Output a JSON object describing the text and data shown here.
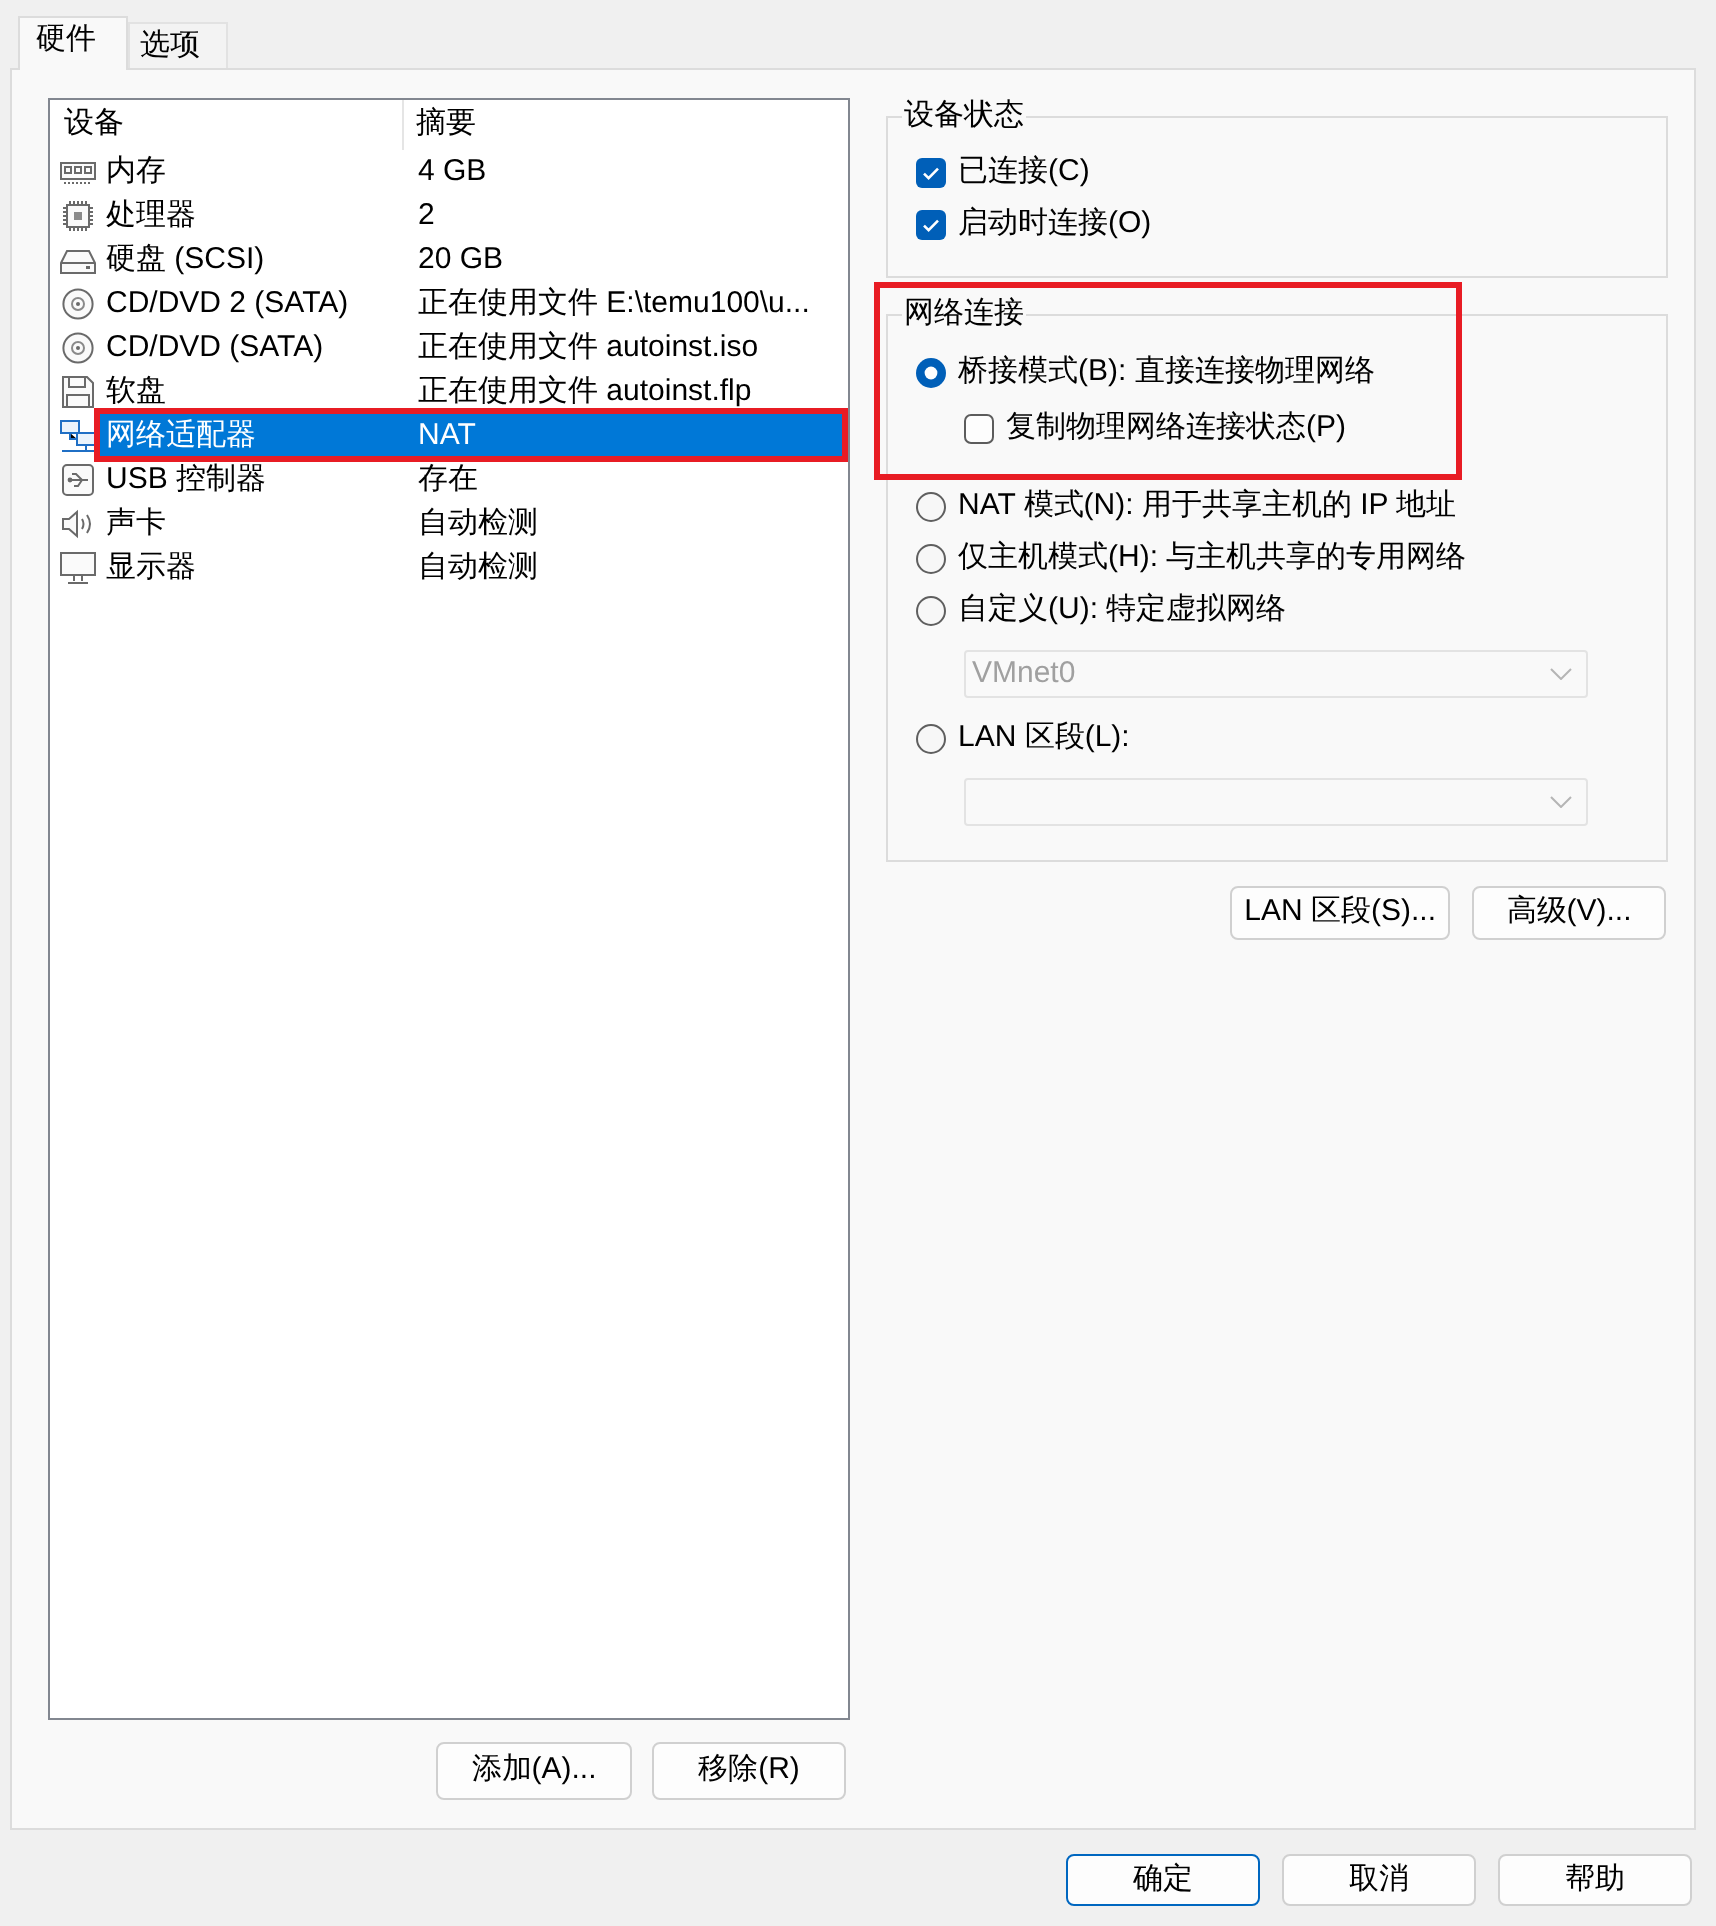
{
  "tabs": [
    {
      "label": "硬件",
      "selected": true
    },
    {
      "label": "选项",
      "selected": false
    }
  ],
  "device_list": {
    "columns": [
      "设备",
      "摘要"
    ],
    "rows": [
      {
        "kind": "memory",
        "device": "内存",
        "summary": "4 GB",
        "selected": false,
        "highlighted": false
      },
      {
        "kind": "processor",
        "device": "处理器",
        "summary": "2",
        "selected": false,
        "highlighted": false
      },
      {
        "kind": "hard_disk",
        "device": "硬盘 (SCSI)",
        "summary": "20 GB",
        "selected": false,
        "highlighted": false
      },
      {
        "kind": "cd_dvd",
        "device": "CD/DVD 2 (SATA)",
        "summary": "正在使用文件 E:\\temu100\\u...",
        "selected": false,
        "highlighted": false
      },
      {
        "kind": "cd_dvd",
        "device": "CD/DVD (SATA)",
        "summary": "正在使用文件 autoinst.iso",
        "selected": false,
        "highlighted": false
      },
      {
        "kind": "floppy",
        "device": "软盘",
        "summary": "正在使用文件 autoinst.flp",
        "selected": false,
        "highlighted": false
      },
      {
        "kind": "network",
        "device": "网络适配器",
        "summary": "NAT",
        "selected": true,
        "highlighted": true
      },
      {
        "kind": "usb",
        "device": "USB 控制器",
        "summary": "存在",
        "selected": false,
        "highlighted": false
      },
      {
        "kind": "sound",
        "device": "声卡",
        "summary": "自动检测",
        "selected": false,
        "highlighted": false
      },
      {
        "kind": "display",
        "device": "显示器",
        "summary": "自动检测",
        "selected": false,
        "highlighted": false
      }
    ]
  },
  "list_buttons": [
    "添加(A)...",
    "移除(R)"
  ],
  "device_status": {
    "title": "设备状态",
    "options": [
      {
        "label": "已连接(C)",
        "checked": true
      },
      {
        "label": "启动时连接(O)",
        "checked": true
      }
    ]
  },
  "network_connection": {
    "title": "网络连接",
    "highlighted": true,
    "options": [
      {
        "label": "桥接模式(B): 直接连接物理网络",
        "selected": true,
        "sub_option": {
          "label": "复制物理网络连接状态(P)",
          "checked": false
        }
      },
      {
        "label": "NAT 模式(N): 用于共享主机的 IP 地址",
        "selected": false
      },
      {
        "label": "仅主机模式(H): 与主机共享的专用网络",
        "selected": false
      },
      {
        "label": "自定义(U): 特定虚拟网络",
        "selected": false,
        "dropdown": {
          "value": "VMnet0",
          "disabled": true
        }
      },
      {
        "label": "LAN 区段(L):",
        "selected": false,
        "dropdown": {
          "disabled": true
        }
      }
    ]
  },
  "network_buttons": [
    "LAN 区段(S)...",
    "高级(V)..."
  ],
  "dialog_buttons": [
    {
      "label": "确定",
      "default": true
    },
    {
      "label": "取消",
      "default": false
    },
    {
      "label": "帮助",
      "default": false
    }
  ]
}
